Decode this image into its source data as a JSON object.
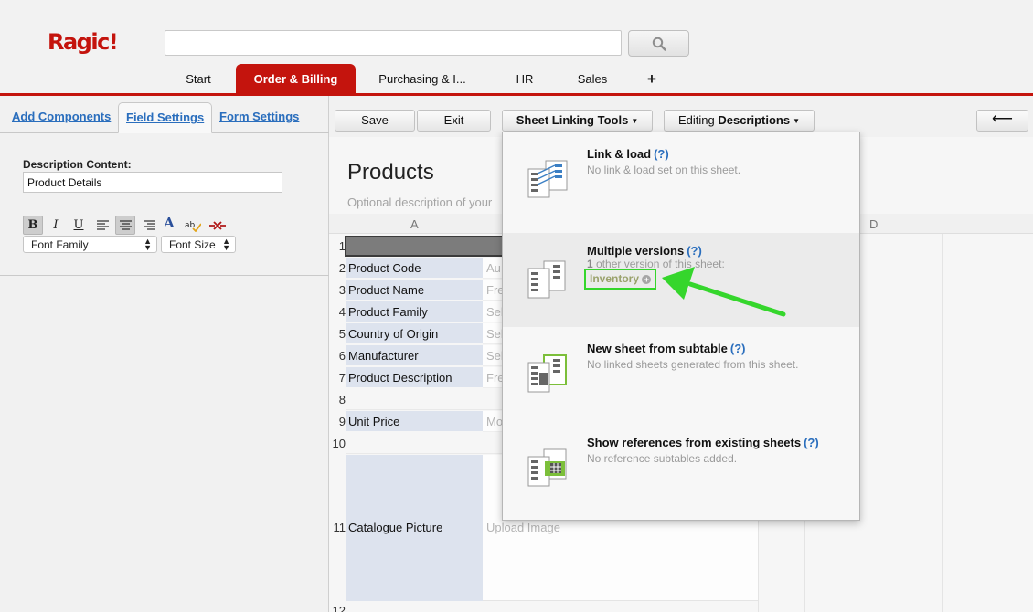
{
  "app": {
    "logo_text": "Ragic!",
    "brand_color": "#c4140d"
  },
  "search": {
    "placeholder": "",
    "icon": "search-icon"
  },
  "nav": {
    "tabs": [
      {
        "label": "Start",
        "active": false
      },
      {
        "label": "Order & Billing",
        "active": true
      },
      {
        "label": "Purchasing & I...",
        "active": false
      },
      {
        "label": "HR",
        "active": false
      },
      {
        "label": "Sales",
        "active": false
      }
    ],
    "add_label": "+"
  },
  "left_panel": {
    "tabs": [
      {
        "label": "Add Components",
        "active": false
      },
      {
        "label": "Field Settings",
        "active": true
      },
      {
        "label": "Form Settings",
        "active": false
      }
    ],
    "description_label": "Description Content:",
    "description_value": "Product Details",
    "format_buttons": [
      "bold-icon",
      "italic-icon",
      "underline-icon",
      "align-left-icon",
      "align-center-icon",
      "align-right-icon",
      "font-color-icon",
      "spellcheck-icon",
      "unlink-icon"
    ],
    "font_family": "Font Family",
    "font_size": "Font Size"
  },
  "toolbar": {
    "save": "Save",
    "exit": "Exit",
    "sheet_linking_tools": "Sheet Linking Tools",
    "editing_prefix": "Editing",
    "editing_mode": "Descriptions",
    "back_arrow": "⟵"
  },
  "sheet": {
    "title": "Products",
    "description_placeholder": "Optional description of your",
    "columns": [
      "A",
      "D"
    ],
    "rows": [
      {
        "num": "1",
        "label": "",
        "value": ""
      },
      {
        "num": "2",
        "label": "Product Code",
        "value": "Au"
      },
      {
        "num": "3",
        "label": "Product Name",
        "value": "Fre"
      },
      {
        "num": "4",
        "label": "Product Family",
        "value": "Sel"
      },
      {
        "num": "5",
        "label": "Country of Origin",
        "value": "Sel"
      },
      {
        "num": "6",
        "label": "Manufacturer",
        "value": "Sel"
      },
      {
        "num": "7",
        "label": "Product Description",
        "value": "Fre"
      },
      {
        "num": "8",
        "label": "",
        "value": ""
      },
      {
        "num": "9",
        "label": "Unit Price",
        "value": "Mo"
      },
      {
        "num": "10",
        "label": "",
        "value": ""
      },
      {
        "num": "11",
        "label": "Catalogue Picture",
        "value": "Upload Image"
      },
      {
        "num": "12",
        "label": "",
        "value": ""
      }
    ]
  },
  "dropdown": {
    "items": [
      {
        "title": "Link & load",
        "help": "(?)",
        "desc": "No link & load set on this sheet."
      },
      {
        "title": "Multiple versions",
        "help": "(?)",
        "count": "1",
        "desc": "other version of this sheet:",
        "link": "Inventory"
      },
      {
        "title": "New sheet from subtable",
        "help": "(?)",
        "desc": "No linked sheets generated from this sheet."
      },
      {
        "title": "Show references from existing sheets",
        "help": "(?)",
        "desc": "No reference subtables added."
      }
    ],
    "highlight_color": "#35d62c"
  }
}
